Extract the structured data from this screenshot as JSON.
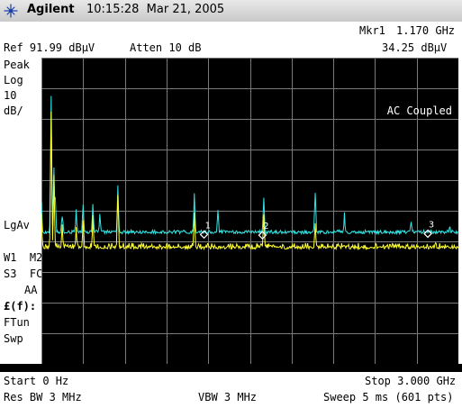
{
  "header": {
    "brand": "Agilent",
    "time": "10:15:28",
    "date": "Mar 21, 2005"
  },
  "marker": {
    "label": "Mkr1",
    "freq": "1.170 GHz",
    "ampl": "34.25 dBμV"
  },
  "ref": {
    "text": "Ref 91.99 dBμV",
    "atten": "Atten 10 dB"
  },
  "left_panel": {
    "detector": "Peak",
    "scale_type": "Log",
    "scale_value": "10",
    "scale_unit": "dB/",
    "avg_label": "LgAv",
    "w1_m2": "W1  M2",
    "s3_fc": "S3  FC",
    "aa": "AA",
    "ff": "£(f):",
    "ftun": "FTun",
    "swp": "Swp"
  },
  "coupling": "AC Coupled",
  "marker_numbers": [
    "1",
    "2",
    "3"
  ],
  "footer": {
    "start": "Start 0 Hz",
    "stop": "Stop 3.000 GHz",
    "rbw": "Res BW 3 MHz",
    "vbw": "VBW 3 MHz",
    "sweep": "Sweep 5 ms (601 pts)"
  },
  "colors": {
    "trace1": "#33e6e6",
    "trace2": "#ffff33",
    "grid": "#7a7a7a",
    "marker": "#ffffff",
    "title_bg": "#d8d8d8"
  },
  "chart_data": {
    "type": "line",
    "x_range_ghz": [
      0,
      3.0
    ],
    "ref_level_dbuv": 91.99,
    "scale_db_per_div": 10,
    "divisions": 10,
    "points": 601,
    "series": [
      {
        "color": "cyan",
        "floor_dbuv": 34.5,
        "peaks": [
          [
            0.0,
            44
          ],
          [
            0.07,
            79
          ],
          [
            0.09,
            57
          ],
          [
            0.1,
            46
          ],
          [
            0.15,
            41
          ],
          [
            0.25,
            42
          ],
          [
            0.3,
            44
          ],
          [
            0.37,
            45
          ],
          [
            0.42,
            40
          ],
          [
            0.55,
            51
          ],
          [
            1.1,
            47
          ],
          [
            1.27,
            43
          ],
          [
            1.6,
            47
          ],
          [
            1.97,
            48
          ],
          [
            2.18,
            41
          ],
          [
            2.66,
            38
          ],
          [
            2.94,
            37
          ]
        ]
      },
      {
        "color": "yellow",
        "floor_dbuv": 29.5,
        "peaks": [
          [
            0.0,
            40
          ],
          [
            0.07,
            74
          ],
          [
            0.09,
            53
          ],
          [
            0.15,
            37
          ],
          [
            0.25,
            36
          ],
          [
            0.3,
            38
          ],
          [
            0.37,
            40
          ],
          [
            0.55,
            48
          ],
          [
            1.1,
            41
          ],
          [
            1.6,
            40
          ],
          [
            1.97,
            38
          ]
        ]
      }
    ],
    "markers": [
      {
        "n": "1",
        "x_ghz": 1.17,
        "y_dbuv": 34.25
      },
      {
        "n": "2",
        "x_ghz": 1.59,
        "y_dbuv": 34.0
      },
      {
        "n": "3",
        "x_ghz": 2.78,
        "y_dbuv": 34.5
      }
    ]
  }
}
